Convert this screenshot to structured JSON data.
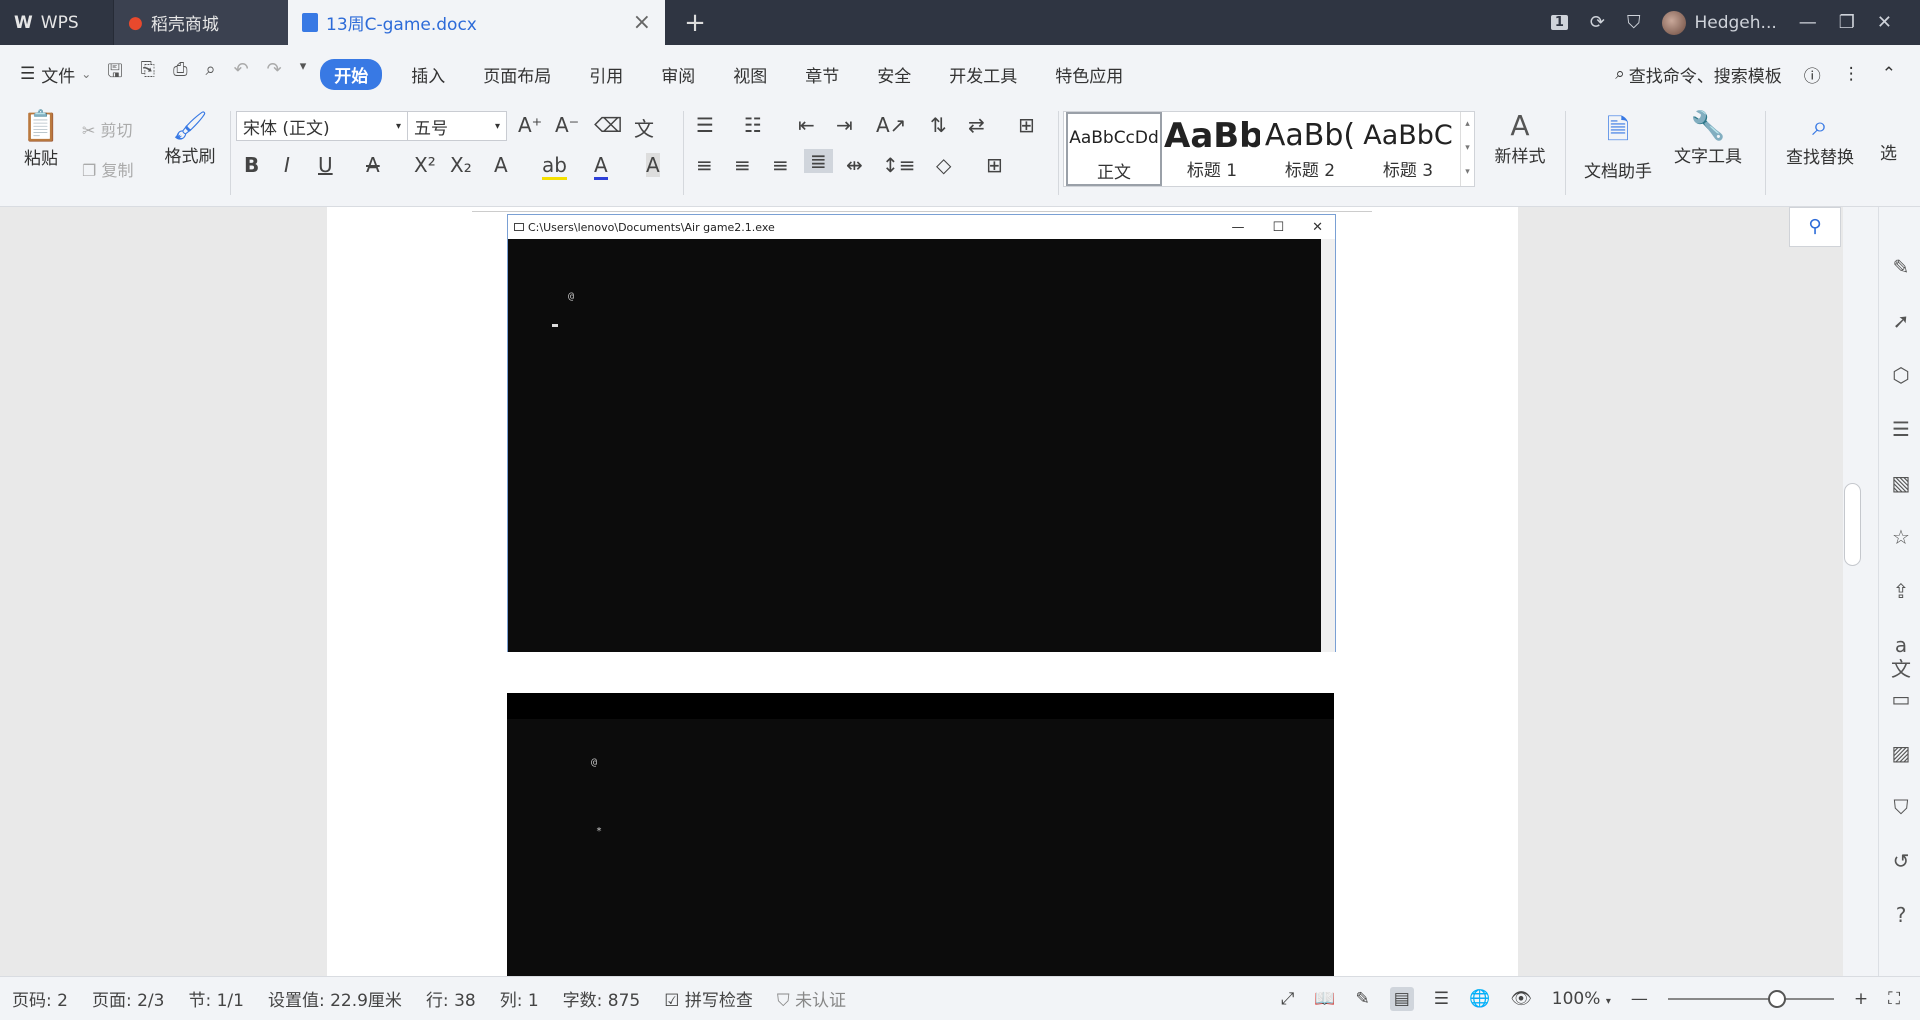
{
  "tabs": {
    "app": "WPS",
    "store": "稻壳商城",
    "document": "13周C-game.docx",
    "new": "+"
  },
  "titlebar": {
    "badge": "1",
    "user": "Hedgeh...",
    "min": "—",
    "restore": "❐",
    "close": "✕"
  },
  "menu": {
    "file": "文件",
    "items": [
      "开始",
      "插入",
      "页面布局",
      "引用",
      "审阅",
      "视图",
      "章节",
      "安全",
      "开发工具",
      "特色应用"
    ],
    "search": "查找命令、搜索模板"
  },
  "ribbon": {
    "paste": "粘贴",
    "cut": "剪切",
    "copy": "复制",
    "format_painter": "格式刷",
    "font_name": "宋体 (正文)",
    "font_size": "五号",
    "styles": [
      {
        "sample": "AaBbCcDd",
        "name": "正文"
      },
      {
        "sample": "AaBb",
        "name": "标题 1"
      },
      {
        "sample": "AaBb(",
        "name": "标题 2"
      },
      {
        "sample": "AaBbC",
        "name": "标题 3"
      }
    ],
    "new_style": "新样式",
    "doc_helper": "文档助手",
    "text_tools": "文字工具",
    "find_replace": "查找替换",
    "select": "选"
  },
  "console": {
    "title": "C:\\Users\\lenovo\\Documents\\Air game2.1.exe",
    "glyph_at": "@",
    "glyph_star": "*"
  },
  "status": {
    "page_code": "页码: 2",
    "pages": "页面: 2/3",
    "section": "节: 1/1",
    "setting": "设置值: 22.9厘米",
    "row": "行: 38",
    "col": "列: 1",
    "word_count": "字数: 875",
    "spellcheck": "拼写检查",
    "unverified": "未认证",
    "zoom": "100%"
  }
}
